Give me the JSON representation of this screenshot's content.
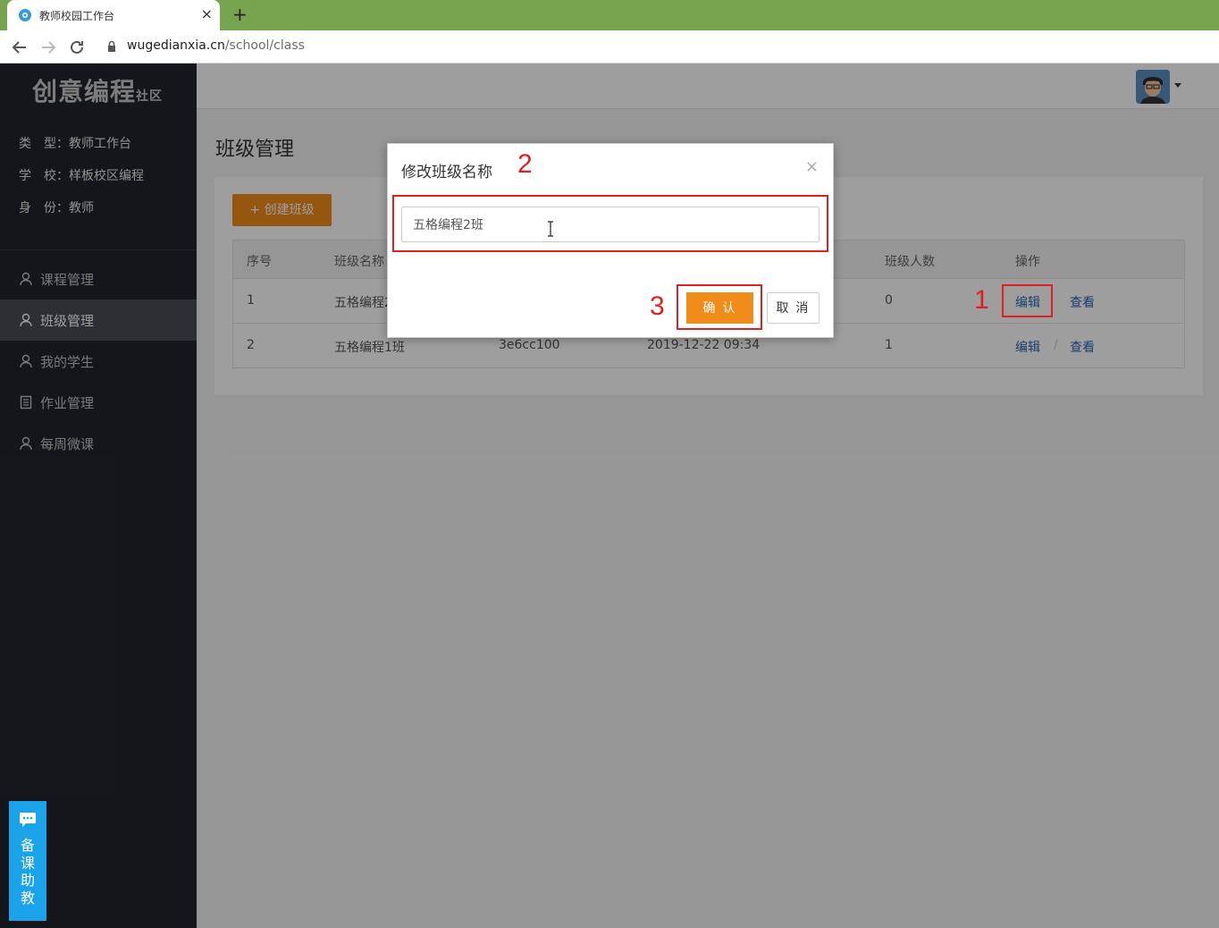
{
  "browser": {
    "tab_title": "教师校园工作台",
    "tab_close": "×",
    "new_tab": "+",
    "url_host": "wugedianxia.cn",
    "url_path": "/school/class"
  },
  "sidebar": {
    "logo": "创意编程",
    "logo_suffix": "社区",
    "info": [
      {
        "text": "类　型：教师工作台"
      },
      {
        "text": "学　校：样板校区编程"
      },
      {
        "text": "身　份：教师"
      }
    ],
    "menu": [
      {
        "label": "课程管理",
        "icon": "user-icon"
      },
      {
        "label": "班级管理",
        "icon": "user-icon",
        "active": true
      },
      {
        "label": "我的学生",
        "icon": "user-icon"
      },
      {
        "label": "作业管理",
        "icon": "document-icon"
      },
      {
        "label": "每周微课",
        "icon": "user-icon"
      }
    ],
    "helper_text": "备课助教"
  },
  "main": {
    "page_title": "班级管理",
    "create_button": "+ 创建班级",
    "table": {
      "headers": [
        "序号",
        "班级名称",
        "班级人数",
        "操作"
      ],
      "rows": [
        {
          "index": "1",
          "name": "五格编程2",
          "count": "0",
          "edit": "编辑",
          "view": "查看"
        },
        {
          "index": "2",
          "name": "五格编程1班",
          "code": "3e6cc100",
          "date": "2019-12-22 09:34",
          "count": "1",
          "edit": "编辑",
          "view": "查看",
          "separator": "/"
        }
      ]
    }
  },
  "modal": {
    "title": "修改班级名称",
    "close": "×",
    "input_value": "五格编程2班",
    "confirm": "确 认",
    "cancel": "取 消"
  },
  "annotations": {
    "n1": "1",
    "n2": "2",
    "n3": "3",
    "color": "#e02020"
  },
  "colors": {
    "accent_orange": "#f08c1a",
    "sidebar_bg": "#23252d",
    "chrome_green": "#78a34f",
    "link_blue": "#2d64b3",
    "helper_blue": "#1aa3e8"
  }
}
